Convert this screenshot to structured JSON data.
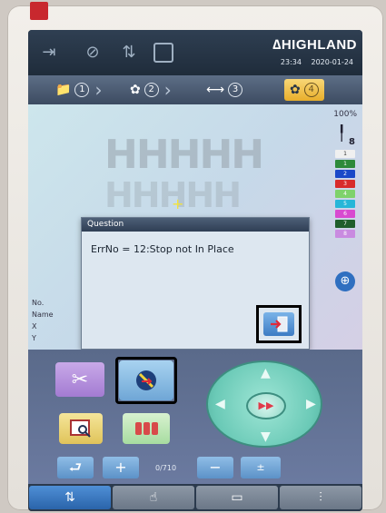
{
  "header": {
    "brand": "∆HIGHLAND",
    "time": "23:34",
    "date": "2020-01-24"
  },
  "steps": [
    {
      "num": "1"
    },
    {
      "num": "2"
    },
    {
      "num": "3"
    },
    {
      "num": "4"
    }
  ],
  "canvas": {
    "zoom": "100%",
    "design_text": "HHHHH",
    "needle_count": "8",
    "needles": [
      {
        "label": "1",
        "color": "#f0f0f0"
      },
      {
        "label": "1",
        "color": "#2e8a3a"
      },
      {
        "label": "2",
        "color": "#1a48c8"
      },
      {
        "label": "3",
        "color": "#d82b2b"
      },
      {
        "label": "4",
        "color": "#7ed26b"
      },
      {
        "label": "5",
        "color": "#26b6d8"
      },
      {
        "label": "6",
        "color": "#d84ad0"
      },
      {
        "label": "7",
        "color": "#1f5e2b"
      },
      {
        "label": "8",
        "color": "#c98be0"
      }
    ],
    "info_labels": [
      "No.",
      "Name",
      "X",
      "Y"
    ]
  },
  "dialog": {
    "title": "Question",
    "message": "ErrNo = 12:Stop not In Place"
  },
  "controls": {
    "counter": "0/710"
  }
}
